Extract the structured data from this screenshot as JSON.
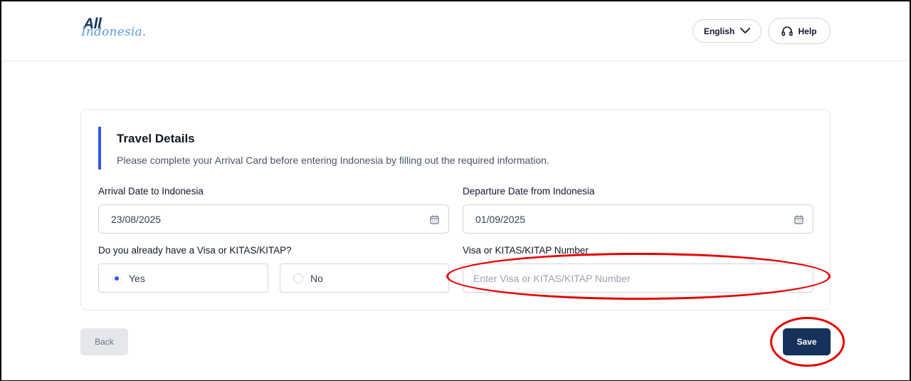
{
  "header": {
    "logo_top": "All",
    "logo_bottom": "Indonesia.",
    "language_label": "English",
    "help_label": "Help"
  },
  "card": {
    "title": "Travel Details",
    "subtitle": "Please complete your Arrival Card before entering Indonesia by filling out the required information."
  },
  "fields": {
    "arrival_label": "Arrival Date to Indonesia",
    "arrival_value": "23/08/2025",
    "departure_label": "Departure Date from Indonesia",
    "departure_value": "01/09/2025",
    "visa_question_label": "Do you already have a Visa or KITAS/KITAP?",
    "visa_options": [
      "Yes",
      "No"
    ],
    "visa_selected": "Yes",
    "visa_number_label": "Visa or KITAS/KITAP Number",
    "visa_number_placeholder": "Enter Visa or KITAS/KITAP Number",
    "visa_number_value": ""
  },
  "actions": {
    "back_label": "Back",
    "save_label": "Save"
  },
  "colors": {
    "accent": "#2f54eb",
    "primary_button": "#14325a",
    "annotation": "#e60000"
  }
}
